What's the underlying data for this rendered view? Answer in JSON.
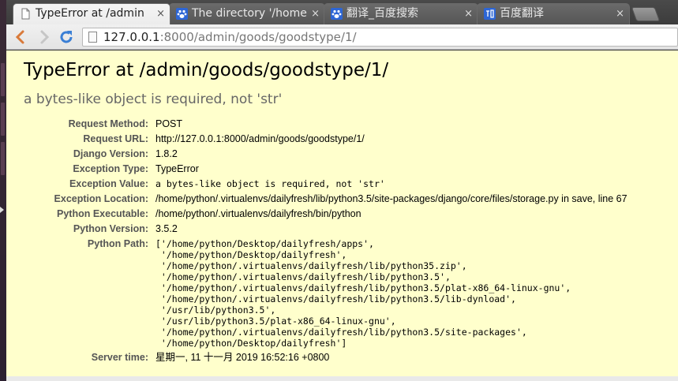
{
  "tabs": [
    {
      "title": "TypeError at /admin",
      "icon": "page-icon",
      "active": true
    },
    {
      "title": "The directory '/home",
      "icon": "baidu-paw-icon",
      "active": false
    },
    {
      "title": "翻译_百度搜索",
      "icon": "baidu-paw-icon",
      "active": false
    },
    {
      "title": "百度翻译",
      "icon": "baidu-translate-icon",
      "active": false
    }
  ],
  "tab_close_glyph": "×",
  "toolbar": {
    "back_icon": "back-arrow-icon",
    "forward_icon": "forward-arrow-icon",
    "reload_icon": "reload-icon",
    "url_host": "127.0.0.1",
    "url_rest": ":8000/admin/goods/goodstype/1/"
  },
  "error": {
    "title": "TypeError at /admin/goods/goodstype/1/",
    "message": "a bytes-like object is required, not 'str'"
  },
  "meta": {
    "request_method": {
      "label": "Request Method:",
      "value": "POST"
    },
    "request_url": {
      "label": "Request URL:",
      "value": "http://127.0.0.1:8000/admin/goods/goodstype/1/"
    },
    "django_version": {
      "label": "Django Version:",
      "value": "1.8.2"
    },
    "exception_type": {
      "label": "Exception Type:",
      "value": "TypeError"
    },
    "exception_value": {
      "label": "Exception Value:",
      "value": "a bytes-like object is required, not 'str'"
    },
    "exception_location": {
      "label": "Exception Location:",
      "value": "/home/python/.virtualenvs/dailyfresh/lib/python3.5/site-packages/django/core/files/storage.py in save, line 67"
    },
    "python_executable": {
      "label": "Python Executable:",
      "value": "/home/python/.virtualenvs/dailyfresh/bin/python"
    },
    "python_version": {
      "label": "Python Version:",
      "value": "3.5.2"
    },
    "python_path": {
      "label": "Python Path:",
      "value": "['/home/python/Desktop/dailyfresh/apps',\n '/home/python/Desktop/dailyfresh',\n '/home/python/.virtualenvs/dailyfresh/lib/python35.zip',\n '/home/python/.virtualenvs/dailyfresh/lib/python3.5',\n '/home/python/.virtualenvs/dailyfresh/lib/python3.5/plat-x86_64-linux-gnu',\n '/home/python/.virtualenvs/dailyfresh/lib/python3.5/lib-dynload',\n '/usr/lib/python3.5',\n '/usr/lib/python3.5/plat-x86_64-linux-gnu',\n '/home/python/.virtualenvs/dailyfresh/lib/python3.5/site-packages',\n '/home/python/Desktop/dailyfresh']"
    },
    "server_time": {
      "label": "Server time:",
      "value": "星期一, 11 十一月 2019 16:52:16 +0800"
    }
  },
  "colors": {
    "page_bg": "#ffffcc",
    "label": "#555555",
    "back_arrow": "#d97a3a",
    "reload": "#3a7fd5",
    "baidu_blue": "#2d66d6"
  }
}
